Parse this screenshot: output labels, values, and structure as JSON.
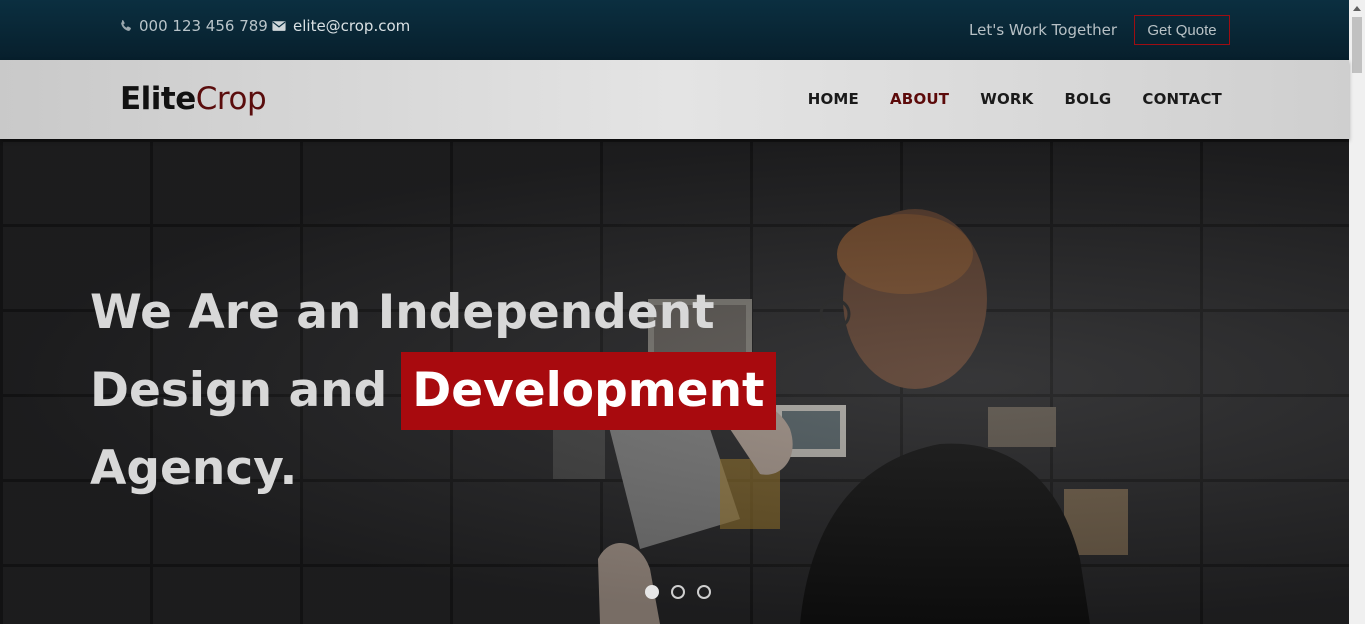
{
  "topbar": {
    "phone": "000 123 456 789",
    "email": "elite@crop.com",
    "work_link": "Let's Work Together",
    "quote_button": "Get Quote"
  },
  "navbar": {
    "logo_part1": "Elite",
    "logo_part2": "Crop",
    "items": [
      {
        "label": "HOME",
        "active": false
      },
      {
        "label": "ABOUT",
        "active": true
      },
      {
        "label": "WORK",
        "active": false
      },
      {
        "label": "BOLG",
        "active": false
      },
      {
        "label": "CONTACT",
        "active": false
      }
    ]
  },
  "hero": {
    "line1": "We Are an Independent",
    "line2_prefix": "Design and",
    "line2_highlight": "Development",
    "line3": "Agency.",
    "slides": 3,
    "active_slide": 1
  },
  "colors": {
    "accent": "#a80a0e",
    "logo_dark": "#5a0d0d",
    "topbar": "#0b2f40"
  },
  "icons": [
    "phone-icon",
    "envelope-icon"
  ]
}
